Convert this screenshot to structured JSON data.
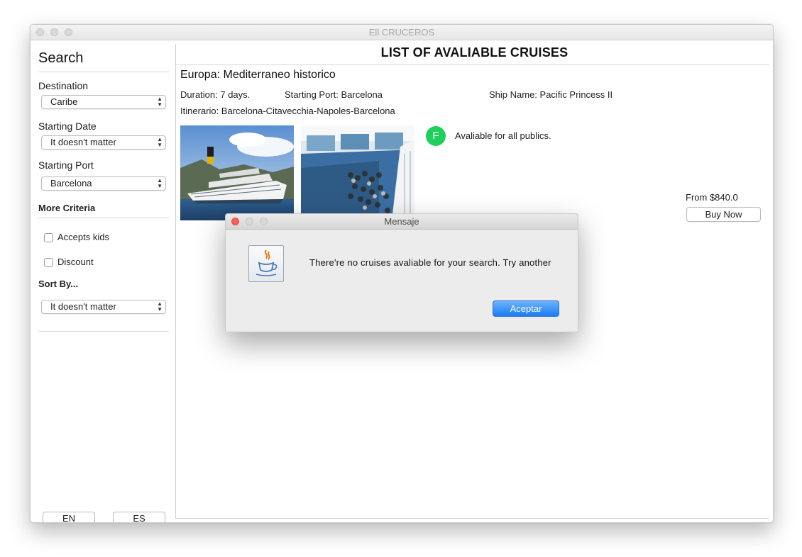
{
  "window": {
    "title": "Ell CRUCEROS"
  },
  "sidebar": {
    "title": "Search",
    "destination": {
      "label": "Destination",
      "value": "Caribe"
    },
    "starting_date": {
      "label": "Starting Date",
      "value": "It doesn't matter"
    },
    "starting_port": {
      "label": "Starting Port",
      "value": "Barcelona"
    },
    "more_criteria": "More Criteria",
    "accepts_kids": {
      "label": "Accepts kids",
      "checked": false
    },
    "discount": {
      "label": "Discount",
      "checked": false
    },
    "sort_by": {
      "label": "Sort By...",
      "value": "It doesn't matter"
    },
    "lang_en": "EN",
    "lang_es": "ES"
  },
  "main": {
    "title": "LIST OF AVALIABLE CRUISES",
    "cruise": {
      "name": "Europa: Mediterraneo historico",
      "duration": "Duration: 7 days.",
      "starting_port": "Starting Port: Barcelona",
      "ship_name": "Ship Name: Pacific Princess II",
      "itinerary": "Itinerario: Barcelona-Citavecchia-Napoles-Barcelona",
      "badge": "F",
      "audience": "Avaliable for all publics.",
      "price": "From $840.0",
      "buy_label": "Buy Now"
    }
  },
  "dialog": {
    "title": "Mensaje",
    "message": "There're no cruises avaliable for your search. Try another",
    "ok_label": "Aceptar"
  },
  "colors": {
    "badge": "#1fcf5c",
    "primary_button": "#1a7cf5",
    "close_traffic_light": "#fc5f57"
  }
}
